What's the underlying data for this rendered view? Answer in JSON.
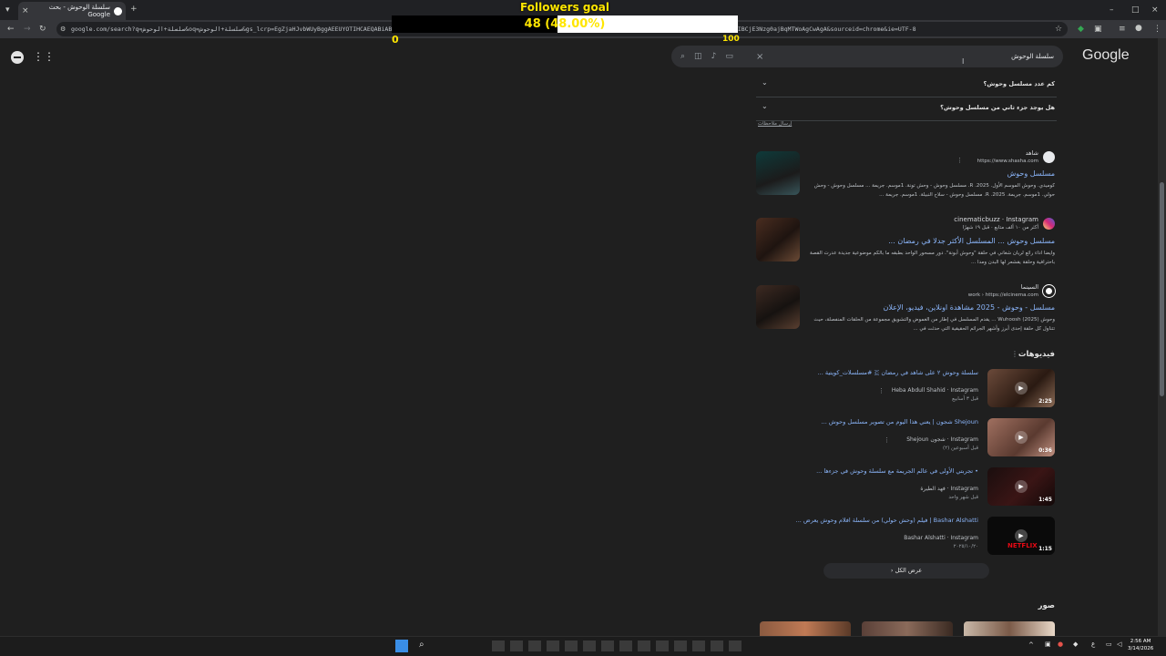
{
  "browser": {
    "tab_title": "سلسلة الوحوش - بحث Google",
    "tab_close": "×",
    "new_tab": "+",
    "url": "google.com/search?q=سلسلة+الوحوش&oq=سلسلة+الوحوش&gs_lcrp=EgZjaHJvbWUyBggAEEUYOTIHCAEQABiABDIHCAIQABiABDIHCAMQABiABDIHCAQQABiABDIHCAUQABiABDIHCAYQABiABDIHCAcQABiABDIHCAgQABiABDIHCAkQABiABNIBCjE3Nzg0ajBqMTWoAgCwAgA&sourceid=chrome&ie=UTF-8"
  },
  "overlay": {
    "title": "Followers goal",
    "count_text": "48 (48.00%)",
    "progress": 0.48,
    "min": "0",
    "max": "100"
  },
  "header": {
    "logo": "Google",
    "query": "سلسلة الوحوش",
    "clear": "×"
  },
  "questions": [
    {
      "text": "كم عدد مسلسل وحوش؟"
    },
    {
      "text": "هل يوجد جزء ثاني من مسلسل وحوش؟"
    }
  ],
  "feedback": "إرسال ملاحظات",
  "results": [
    {
      "site": "شاهد",
      "url": "https://www.shasha.com",
      "title": "مسلسل وحوش",
      "snippet": "كوميدي. وحوش الموسم الأول. 2025. R. مسلسل وحوش - وحش تونة. 1موسم. جريمة ... مسلسل وحوش - وحش حولي. 1موسم. جريمة. 2025. R. مسلسل وحوش - سلاح النبيلة. 1موسم. جريمة ..."
    },
    {
      "site": "cinematicbuzz · Instagram",
      "url": "أكثر من ١٠ ألف متابع · قبل ١٩ شهرًا",
      "title": "مسلسل وحوش ... المسلسل الأكثر جدلا في رمضان ...",
      "snippet": "وايضا اداء رائع لريان شغاني في حلقة \"وحوش أبونة\". دور مسحور الواحد بطبقه ما بالكم موضوعية جديدة عدرت القصة باحترافية وحلقة يقشعر لها البدن ومدا ..."
    },
    {
      "site": "السينما",
      "url": "work › https://elcinema.com",
      "title": "مسلسل - وحوش - 2025 مشاهدة اونلاين، فيديو، الإعلان",
      "snippet": "وحوش (Wuhoosh (2025 ... يقدم المسلسل في إطار من الغموض والتشويق مجموعة من الحلقات المنفصلة، حيث تتناول كل حلقة إحدى أبرز وأشهر الجرائم الحقيقية التي حدثت في ..."
    }
  ],
  "videos_section": "فيديوهات",
  "videos": [
    {
      "title": "سلسلة وحوش ٢ على شاهد في رمضان 🇨 #مسلسلات_كويتية ...",
      "source": "Heba Abdull Shahid · Instagram",
      "date": "قبل ٣ أسابيع",
      "duration": "2:25"
    },
    {
      "title": "Shejoun شجون | يعني هذا اليوم من تصوير مسلسل وحوش ...",
      "source": "Shejoun شجون · Instagram",
      "date": "قبل أسبوعين (٢)",
      "duration": "0:36"
    },
    {
      "title": "• تجربتي الأولى في عالم الجريمة مع سلسلة وحوش في جزءها ...",
      "source": "فهد الطيرة · Instagram",
      "date": "قبل شهر واحد",
      "duration": "1:45"
    },
    {
      "title": "Bashar Alshatti | فيلم (وحش حولي) من سلسلة افلام وحوش يعرض ...",
      "source": "Bashar Alshatti · Instagram",
      "date": "٢٠٢٥/١٠/٢٠",
      "duration": "1:15"
    }
  ],
  "show_all": "عرض الكل",
  "images_section": "صور",
  "taskbar": {
    "time": "2:56 AM",
    "date": "3/14/2026"
  }
}
